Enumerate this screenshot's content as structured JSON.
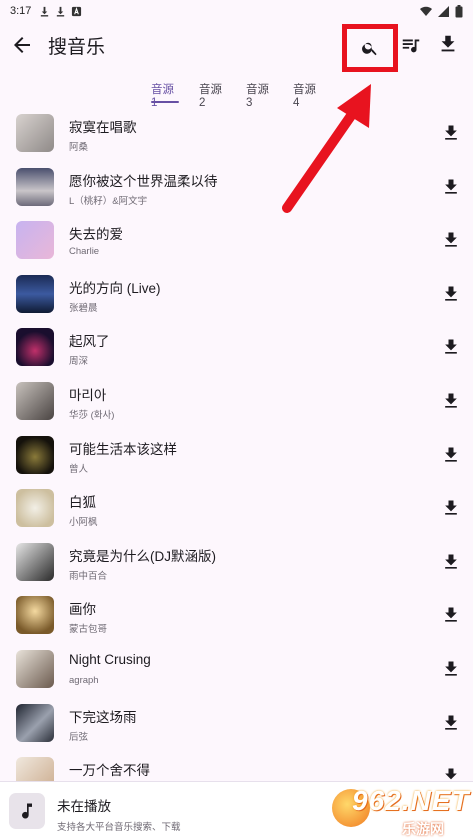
{
  "status_bar": {
    "time": "3:17"
  },
  "appbar": {
    "title": "搜音乐"
  },
  "tabs": [
    {
      "label": "音源1",
      "active": true
    },
    {
      "label": "音源2",
      "active": false
    },
    {
      "label": "音源3",
      "active": false
    },
    {
      "label": "音源4",
      "active": false
    }
  ],
  "songs": [
    {
      "title": "寂寞在唱歌",
      "artist": "阿桑"
    },
    {
      "title": "愿你被这个世界温柔以待",
      "artist": "L（桃籽）&阿文宇"
    },
    {
      "title": "失去的爱",
      "artist": "Charlie"
    },
    {
      "title": "光的方向 (Live)",
      "artist": "张碧晨"
    },
    {
      "title": "起风了",
      "artist": "周深"
    },
    {
      "title": "마리아",
      "artist": "华莎 (화사)"
    },
    {
      "title": "可能生活本该这样",
      "artist": "曾人"
    },
    {
      "title": "白狐",
      "artist": "小阿枫"
    },
    {
      "title": "究竟是为什么(DJ默涵版)",
      "artist": "雨中百合"
    },
    {
      "title": "画你",
      "artist": "蒙古包哥"
    },
    {
      "title": "Night Crusing",
      "artist": "agraph"
    },
    {
      "title": "下完这场雨",
      "artist": "后弦"
    },
    {
      "title": "一万个舍不得",
      "artist": ""
    }
  ],
  "player": {
    "title": "未在播放",
    "subtitle": "支持各大平台音乐搜索、下载"
  },
  "watermark": {
    "top": "962.NET",
    "bottom": "乐游网"
  },
  "colors": {
    "accent": "#6750a4",
    "highlight": "#e8131f",
    "background": "#fdf7fd"
  },
  "icons": {
    "back": "arrow-left-icon",
    "search": "search-icon",
    "queue": "queue-music-icon",
    "download": "download-icon",
    "player": "music-note-icon"
  }
}
